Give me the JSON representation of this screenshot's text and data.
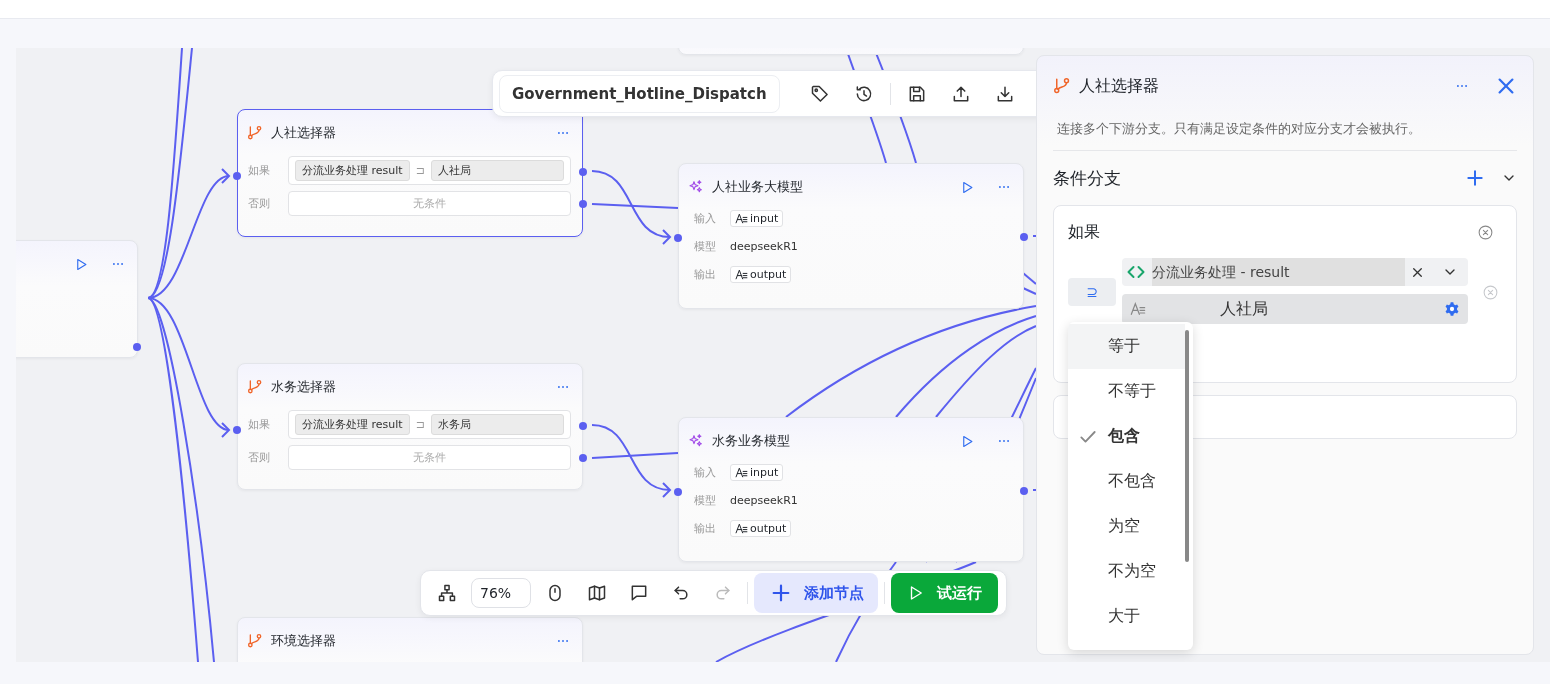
{
  "canvas": {
    "nodes": [
      {
        "kind": "stub"
      },
      {
        "kind": "start"
      },
      {
        "kind": "condition",
        "title": "人社选择器",
        "selected": true,
        "if_label": "如果",
        "variable": "分流业务处理 result",
        "operator": "⊐",
        "value": "人社局",
        "else_label": "否则",
        "else_text": "无条件"
      },
      {
        "kind": "llm",
        "title": "人社业务大模型",
        "selected": false,
        "input_label": "输入",
        "input": "input",
        "model_label": "模型",
        "model": "deepseekR1",
        "output_label": "输出",
        "output": "output"
      },
      {
        "kind": "condition",
        "title": "水务选择器",
        "selected": false,
        "if_label": "如果",
        "variable": "分流业务处理 result",
        "operator": "⊐",
        "value": "水务局",
        "else_label": "否则",
        "else_text": "无条件"
      },
      {
        "kind": "llm",
        "title": "水务业务模型",
        "selected": false,
        "input_label": "输入",
        "input": "input",
        "model_label": "模型",
        "model": "deepseekR1",
        "output_label": "输出",
        "output": "output"
      },
      {
        "kind": "condition",
        "title": "环境选择器",
        "selected": false
      }
    ]
  },
  "top_toolbar": {
    "title": "Government_Hotline_Dispatch",
    "actions": [
      {
        "kind": "tag"
      },
      {
        "kind": "history"
      },
      {
        "kind": "save"
      },
      {
        "kind": "upload"
      },
      {
        "kind": "download"
      }
    ]
  },
  "bottom_toolbar": {
    "items": [
      {
        "kind": "layout"
      },
      {
        "kind": "zoom",
        "value": "76%"
      },
      {
        "kind": "mouse"
      },
      {
        "kind": "map"
      },
      {
        "kind": "comment"
      },
      {
        "kind": "undo",
        "disabled": false
      },
      {
        "kind": "redo",
        "disabled": true
      },
      {
        "kind": "add",
        "label": "添加节点"
      },
      {
        "kind": "run",
        "label": "试运行"
      }
    ]
  },
  "panel": {
    "title": "人社选择器",
    "description": "连接多个下游分支。只有满足设定条件的对应分支才会被执行。",
    "section": "条件分支",
    "branches": [
      {
        "kind": "if",
        "label": "如果",
        "operator": "⊇",
        "variable": "分流业务处理 - result",
        "value": "人社局"
      },
      {
        "kind": "empty"
      }
    ],
    "operator_menu": {
      "items": [
        {
          "label": "等于",
          "highlighted": true,
          "selected": false
        },
        {
          "label": "不等于",
          "highlighted": false,
          "selected": false
        },
        {
          "label": "包含",
          "highlighted": false,
          "selected": true
        },
        {
          "label": "不包含",
          "highlighted": false,
          "selected": false
        },
        {
          "label": "为空",
          "highlighted": false,
          "selected": false
        },
        {
          "label": "不为空",
          "highlighted": false,
          "selected": false
        },
        {
          "label": "大于",
          "highlighted": false,
          "selected": false
        }
      ]
    }
  }
}
